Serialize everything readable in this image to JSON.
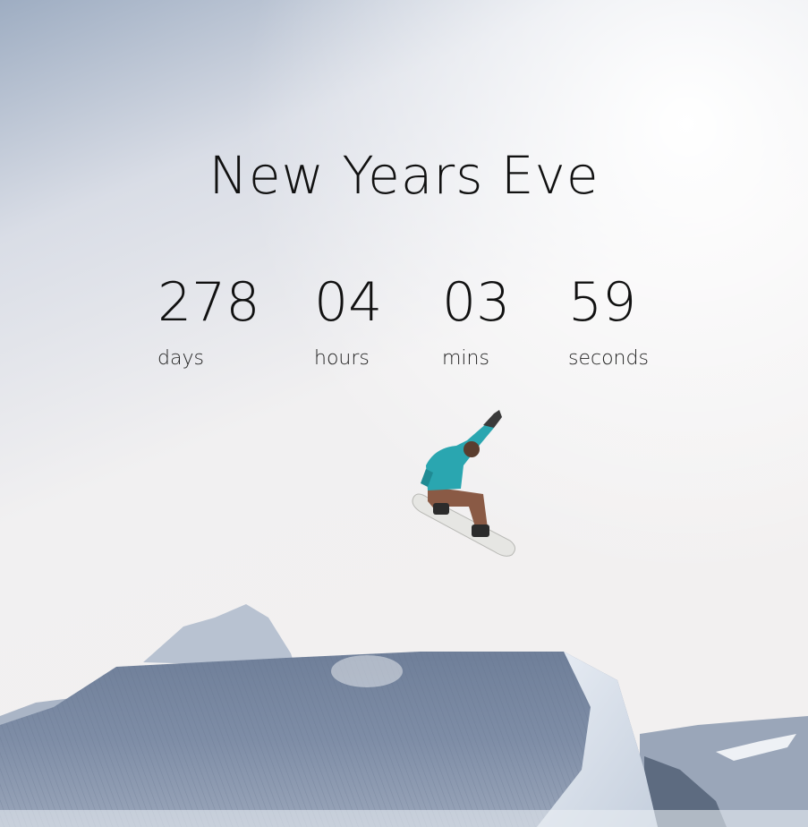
{
  "page": {
    "title": "New Years Eve"
  },
  "countdown": {
    "days": {
      "value": "278",
      "label": "days"
    },
    "hours": {
      "value": "04",
      "label": "hours"
    },
    "mins": {
      "value": "03",
      "label": "mins"
    },
    "seconds": {
      "value": "59",
      "label": "seconds"
    }
  },
  "background": {
    "scene": "snowboarder-jump-icon",
    "sky_top": "#a9b6c8",
    "sky_mid": "#e4e6ec",
    "sky_light": "#f4f2f2",
    "snow": "#dfe3ea",
    "snow_shadow": "#7b8aa3",
    "jacket": "#2aa6b0",
    "pants": "#8a5a45"
  }
}
